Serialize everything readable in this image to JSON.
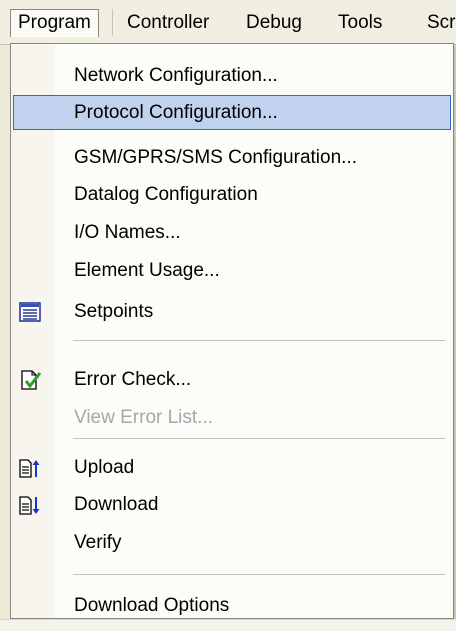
{
  "menubar": {
    "items": [
      {
        "label": "Program"
      },
      {
        "label": "Controller"
      },
      {
        "label": "Debug"
      },
      {
        "label": "Tools"
      },
      {
        "label": "Scr"
      }
    ]
  },
  "menu": {
    "items": [
      {
        "label": "Network Configuration..."
      },
      {
        "label": "Protocol Configuration..."
      },
      {
        "label": "GSM/GPRS/SMS  Configuration..."
      },
      {
        "label": "Datalog Configuration"
      },
      {
        "label": "I/O Names..."
      },
      {
        "label": "Element Usage..."
      },
      {
        "label": "Setpoints",
        "icon": "setpoints-icon"
      },
      {
        "label": "Error Check...",
        "icon": "error-check-icon"
      },
      {
        "label": "View Error List...",
        "disabled": true
      },
      {
        "label": "Upload",
        "icon": "upload-icon"
      },
      {
        "label": "Download",
        "icon": "download-icon"
      },
      {
        "label": "Verify"
      },
      {
        "label": "Download Options"
      }
    ]
  },
  "colors": {
    "highlight_fill": "#c1d2ee",
    "highlight_border": "#316ac5",
    "disabled_text": "#a7a6aa"
  }
}
